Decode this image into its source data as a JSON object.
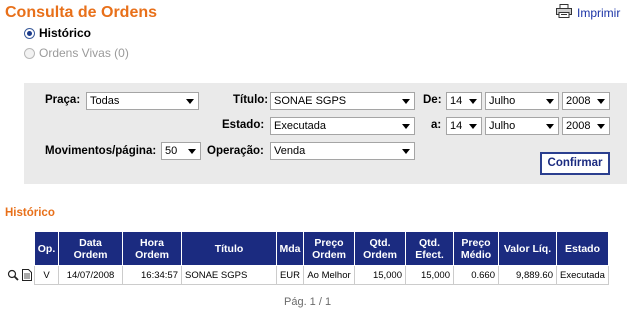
{
  "header": {
    "title": "Consulta de Ordens",
    "print_label": "Imprimir"
  },
  "mode": {
    "historico": "Histórico",
    "vivas": "Ordens Vivas (0)",
    "selected": "historico"
  },
  "filters": {
    "praca_label": "Praça:",
    "praca_value": "Todas",
    "titulo_label": "Título:",
    "titulo_value": "SONAE SGPS",
    "estado_label": "Estado:",
    "estado_value": "Executada",
    "mov_label": "Movimentos/página:",
    "mov_value": "50",
    "operacao_label": "Operação:",
    "operacao_value": "Venda",
    "de_label": "De:",
    "a_label": "a:",
    "de": {
      "day": "14",
      "month": "Julho",
      "year": "2008"
    },
    "a": {
      "day": "14",
      "month": "Julho",
      "year": "2008"
    },
    "confirm_label": "Confirmar"
  },
  "results": {
    "section_title": "Histórico",
    "columns": {
      "op": "Op.",
      "data1": "Data",
      "data2": "Ordem",
      "hora1": "Hora",
      "hora2": "Ordem",
      "titulo": "Título",
      "mda": "Mda",
      "preco1": "Preço",
      "preco2": "Ordem",
      "qtd_ord1": "Qtd.",
      "qtd_ord2": "Ordem",
      "qtd_ef1": "Qtd.",
      "qtd_ef2": "Efect.",
      "pm1": "Preço",
      "pm2": "Médio",
      "valor": "Valor Líq.",
      "estado": "Estado"
    },
    "rows": [
      {
        "op": "V",
        "data": "14/07/2008",
        "hora": "16:34:57",
        "titulo": "SONAE SGPS",
        "mda": "EUR",
        "preco": "Ao Melhor",
        "qtd_ordem": "15,000",
        "qtd_efect": "15,000",
        "preco_medio": "0.660",
        "valor": "9,889.60",
        "estado": "Executada"
      }
    ],
    "pagination": "Pág. 1 / 1"
  },
  "colors": {
    "accent": "#e8701a",
    "header_bg": "#1b2b80",
    "panel_bg": "#eaeaea"
  }
}
